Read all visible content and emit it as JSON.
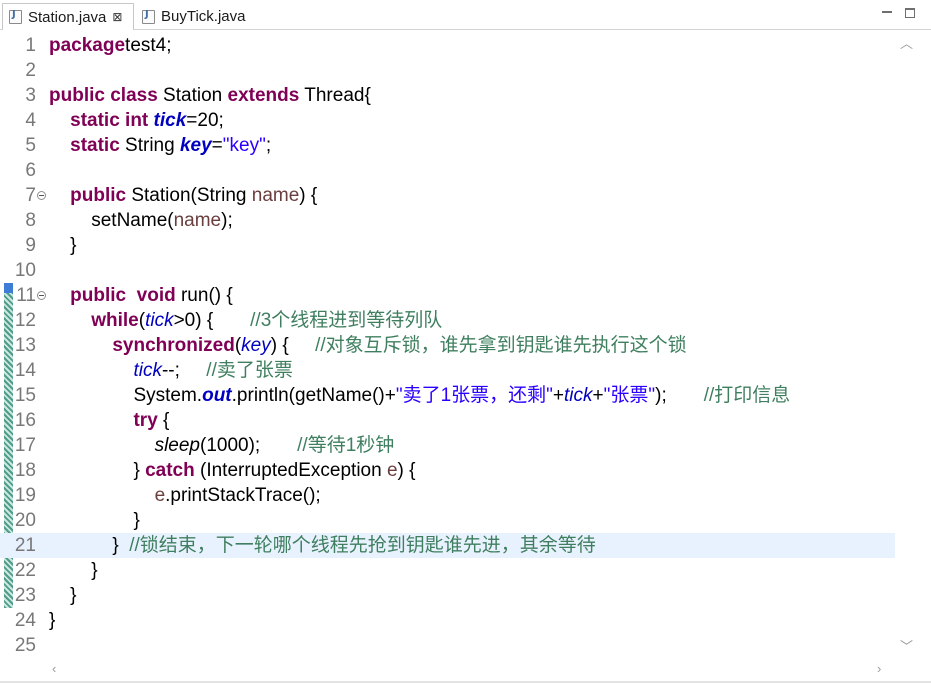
{
  "tabs": [
    {
      "label": "Station.java",
      "active": true,
      "close": "⊠"
    },
    {
      "label": "BuyTick.java",
      "active": false
    }
  ],
  "window_controls": [
    "minimize",
    "maximize"
  ],
  "editor": {
    "highlighted_line": 21,
    "lines": [
      {
        "n": "1",
        "tokens": [
          [
            "kw",
            "package"
          ],
          [
            "",
            "test4;"
          ]
        ]
      },
      {
        "n": "2",
        "tokens": []
      },
      {
        "n": "3",
        "tokens": [
          [
            "kw",
            "public"
          ],
          [
            "",
            " "
          ],
          [
            "kw",
            "class"
          ],
          [
            "",
            " Station "
          ],
          [
            "kw",
            "extends"
          ],
          [
            "",
            " Thread{"
          ]
        ]
      },
      {
        "n": "4",
        "tokens": [
          [
            "",
            "    "
          ],
          [
            "kw",
            "static"
          ],
          [
            "",
            " "
          ],
          [
            "kw",
            "int"
          ],
          [
            "",
            " "
          ],
          [
            "sfld",
            "tick"
          ],
          [
            "",
            "=20;"
          ]
        ]
      },
      {
        "n": "5",
        "tokens": [
          [
            "",
            "    "
          ],
          [
            "kw",
            "static"
          ],
          [
            "",
            " String "
          ],
          [
            "sfld",
            "key"
          ],
          [
            "",
            "="
          ],
          [
            "str",
            "\"key\""
          ],
          [
            "",
            ";"
          ]
        ]
      },
      {
        "n": "6",
        "tokens": []
      },
      {
        "n": "7",
        "fold": true,
        "tokens": [
          [
            "",
            "    "
          ],
          [
            "kw",
            "public"
          ],
          [
            "",
            " Station(String "
          ],
          [
            "param",
            "name"
          ],
          [
            "",
            ") {"
          ]
        ]
      },
      {
        "n": "8",
        "tokens": [
          [
            "",
            "        setName("
          ],
          [
            "param",
            "name"
          ],
          [
            "",
            ");"
          ]
        ]
      },
      {
        "n": "9",
        "tokens": [
          [
            "",
            "    }"
          ]
        ]
      },
      {
        "n": "10",
        "tokens": []
      },
      {
        "n": "11",
        "fold": true,
        "tokens": [
          [
            "",
            "    "
          ],
          [
            "kw",
            "public"
          ],
          [
            "",
            "  "
          ],
          [
            "kw",
            "void"
          ],
          [
            "",
            " run() {"
          ]
        ]
      },
      {
        "n": "12",
        "tokens": [
          [
            "",
            "        "
          ],
          [
            "kw",
            "while"
          ],
          [
            "",
            "("
          ],
          [
            "fld",
            "tick"
          ],
          [
            "",
            ">0) {       "
          ],
          [
            "cmt",
            "//3个线程进到等待列队"
          ]
        ]
      },
      {
        "n": "13",
        "tokens": [
          [
            "",
            "            "
          ],
          [
            "kw",
            "synchronized"
          ],
          [
            "",
            "("
          ],
          [
            "fld",
            "key"
          ],
          [
            "",
            ") {     "
          ],
          [
            "cmt",
            "//对象互斥锁，谁先拿到钥匙谁先执行这个锁"
          ]
        ]
      },
      {
        "n": "14",
        "tokens": [
          [
            "",
            "                "
          ],
          [
            "fld",
            "tick"
          ],
          [
            "",
            "--;     "
          ],
          [
            "cmt",
            "//卖了张票"
          ]
        ]
      },
      {
        "n": "15",
        "tokens": [
          [
            "",
            "                System."
          ],
          [
            "sfld",
            "out"
          ],
          [
            "",
            ".println(getName()+"
          ],
          [
            "str",
            "\"卖了1张票，还剩\""
          ],
          [
            "",
            "+"
          ],
          [
            "fld",
            "tick"
          ],
          [
            "",
            "+"
          ],
          [
            "str",
            "\"张票\""
          ],
          [
            "",
            ");       "
          ],
          [
            "cmt",
            "//打印信息"
          ]
        ]
      },
      {
        "n": "16",
        "tokens": [
          [
            "",
            "                "
          ],
          [
            "kw",
            "try"
          ],
          [
            "",
            " {"
          ]
        ]
      },
      {
        "n": "17",
        "tokens": [
          [
            "",
            "                    "
          ],
          [
            "smeth",
            "sleep"
          ],
          [
            "",
            "(1000);       "
          ],
          [
            "cmt",
            "//等待1秒钟"
          ]
        ]
      },
      {
        "n": "18",
        "tokens": [
          [
            "",
            "                } "
          ],
          [
            "kw",
            "catch"
          ],
          [
            "",
            " (InterruptedException "
          ],
          [
            "param",
            "e"
          ],
          [
            "",
            ") {"
          ]
        ]
      },
      {
        "n": "19",
        "tokens": [
          [
            "",
            "                    "
          ],
          [
            "param",
            "e"
          ],
          [
            "",
            ".printStackTrace();"
          ]
        ]
      },
      {
        "n": "20",
        "tokens": [
          [
            "",
            "                }"
          ]
        ]
      },
      {
        "n": "21",
        "tokens": [
          [
            "",
            "            }  "
          ],
          [
            "cmt",
            "//锁结束，下一轮哪个线程先抢到钥匙谁先进，其余等待"
          ]
        ]
      },
      {
        "n": "22",
        "tokens": [
          [
            "",
            "        }"
          ]
        ]
      },
      {
        "n": "23",
        "tokens": [
          [
            "",
            "    }"
          ]
        ]
      },
      {
        "n": "24",
        "tokens": [
          [
            "",
            "}"
          ]
        ]
      },
      {
        "n": "25",
        "tokens": []
      }
    ]
  },
  "scrollbar_arrows": {
    "up": "︿",
    "down": "﹀",
    "left": "‹",
    "right": "›"
  }
}
